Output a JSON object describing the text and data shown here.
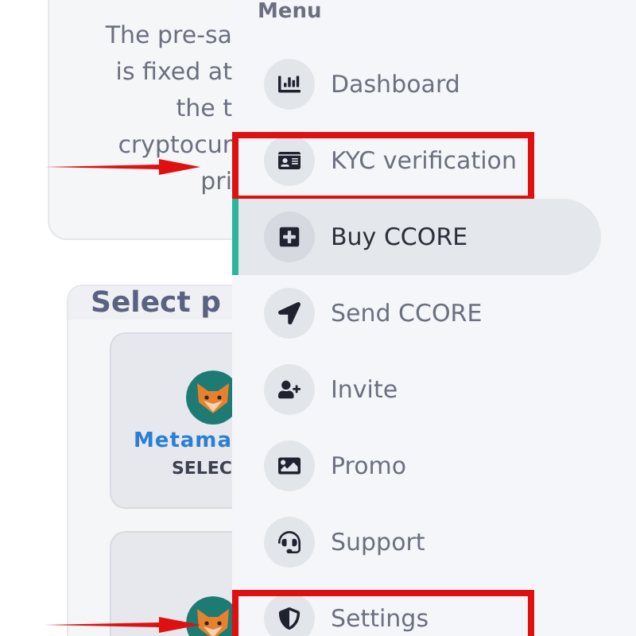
{
  "intro_card": {
    "lines": [
      "The pre-sa",
      "is fixed at",
      "the t",
      "cryptocur",
      "pri"
    ]
  },
  "wallet_panel": {
    "title": "Select p",
    "options": [
      {
        "kind": "labeled",
        "name": "Metama",
        "action": "SELEC"
      },
      {
        "kind": "cut_off"
      }
    ]
  },
  "menu": {
    "title": "Menu",
    "items": [
      {
        "label": "Dashboard",
        "selected": false,
        "highlighted": false
      },
      {
        "label": "KYC verification",
        "selected": false,
        "highlighted": true
      },
      {
        "label": "Buy CCORE",
        "selected": true,
        "highlighted": false
      },
      {
        "label": "Send CCORE",
        "selected": false,
        "highlighted": false
      },
      {
        "label": "Invite",
        "selected": false,
        "highlighted": false
      },
      {
        "label": "Promo",
        "selected": false,
        "highlighted": false
      },
      {
        "label": "Support",
        "selected": false,
        "highlighted": false
      },
      {
        "label": "Settings",
        "selected": false,
        "highlighted": true
      }
    ]
  }
}
